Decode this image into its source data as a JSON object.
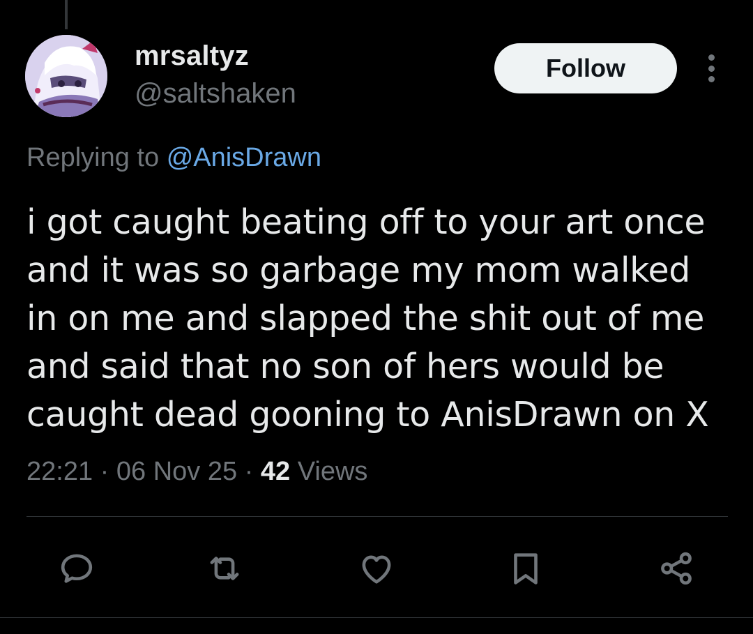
{
  "post": {
    "display_name": "mrsaltyz",
    "handle": "@saltshaken",
    "follow_label": "Follow",
    "replying_to_prefix": "Replying to",
    "replying_to_mention": "@AnisDrawn",
    "text_lines": [
      "i got caught beating off to your art once",
      "and it was so garbage my mom walked",
      "in on me and slapped the shit out of me",
      "and said that no son of hers would be",
      "caught dead gooning to AnisDrawn on X"
    ],
    "time": "22:21",
    "separator": "·",
    "date": "06 Nov 25",
    "views_count": "42",
    "views_label": "Views"
  },
  "actions": [
    {
      "icon": "reply-icon"
    },
    {
      "icon": "repost-icon"
    },
    {
      "icon": "like-icon"
    },
    {
      "icon": "bookmark-icon"
    },
    {
      "icon": "share-icon"
    }
  ],
  "colors": {
    "background": "#000000",
    "text_primary": "#e7e9ea",
    "text_secondary": "#71767b",
    "mention": "#6aa9e6",
    "follow_button": "#eff3f4"
  }
}
